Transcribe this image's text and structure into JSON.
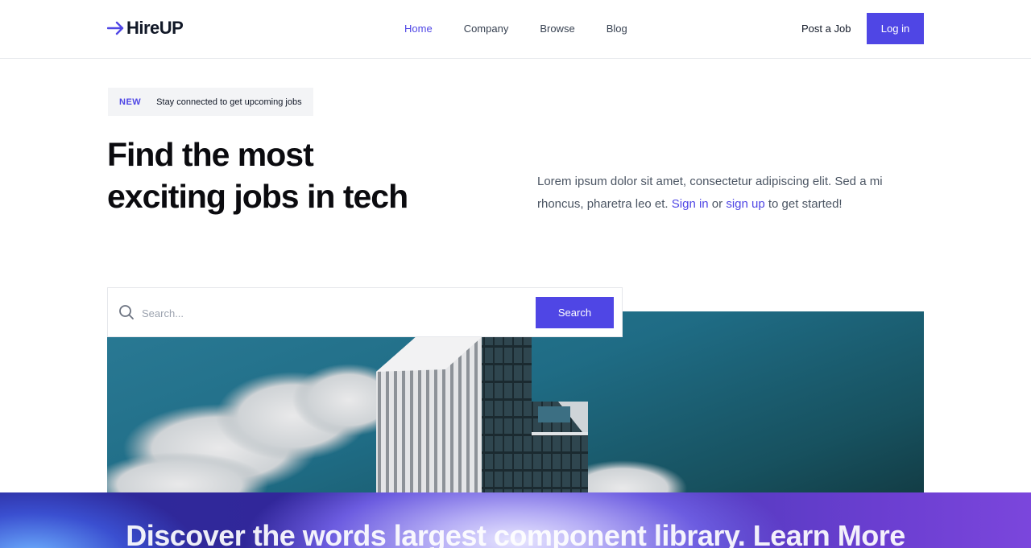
{
  "header": {
    "logo_text": "HireUP",
    "nav": [
      {
        "label": "Home",
        "active": true
      },
      {
        "label": "Company",
        "active": false
      },
      {
        "label": "Browse",
        "active": false
      },
      {
        "label": "Blog",
        "active": false
      }
    ],
    "post_job_label": "Post a Job",
    "login_label": "Log in"
  },
  "badge": {
    "tag": "NEW",
    "text": "Stay connected to get upcoming jobs"
  },
  "hero": {
    "title_line1": "Find the most",
    "title_line2": "exciting jobs in tech",
    "desc_before": "Lorem ipsum dolor sit amet, consectetur adipiscing elit. Sed a mi rhoncus, pharetra leo et. ",
    "sign_in": "Sign in",
    "desc_or": " or ",
    "sign_up": "sign up",
    "desc_after": " to get started!"
  },
  "search": {
    "placeholder": "Search...",
    "value": "",
    "button_label": "Search"
  },
  "banner": {
    "text": "Discover the words largest component library. Learn More"
  },
  "colors": {
    "accent": "#4f46e5",
    "text_dark": "#111827",
    "text_muted": "#4b5563"
  },
  "icons": {
    "logo": "arrow-right-icon",
    "search": "search-icon"
  }
}
